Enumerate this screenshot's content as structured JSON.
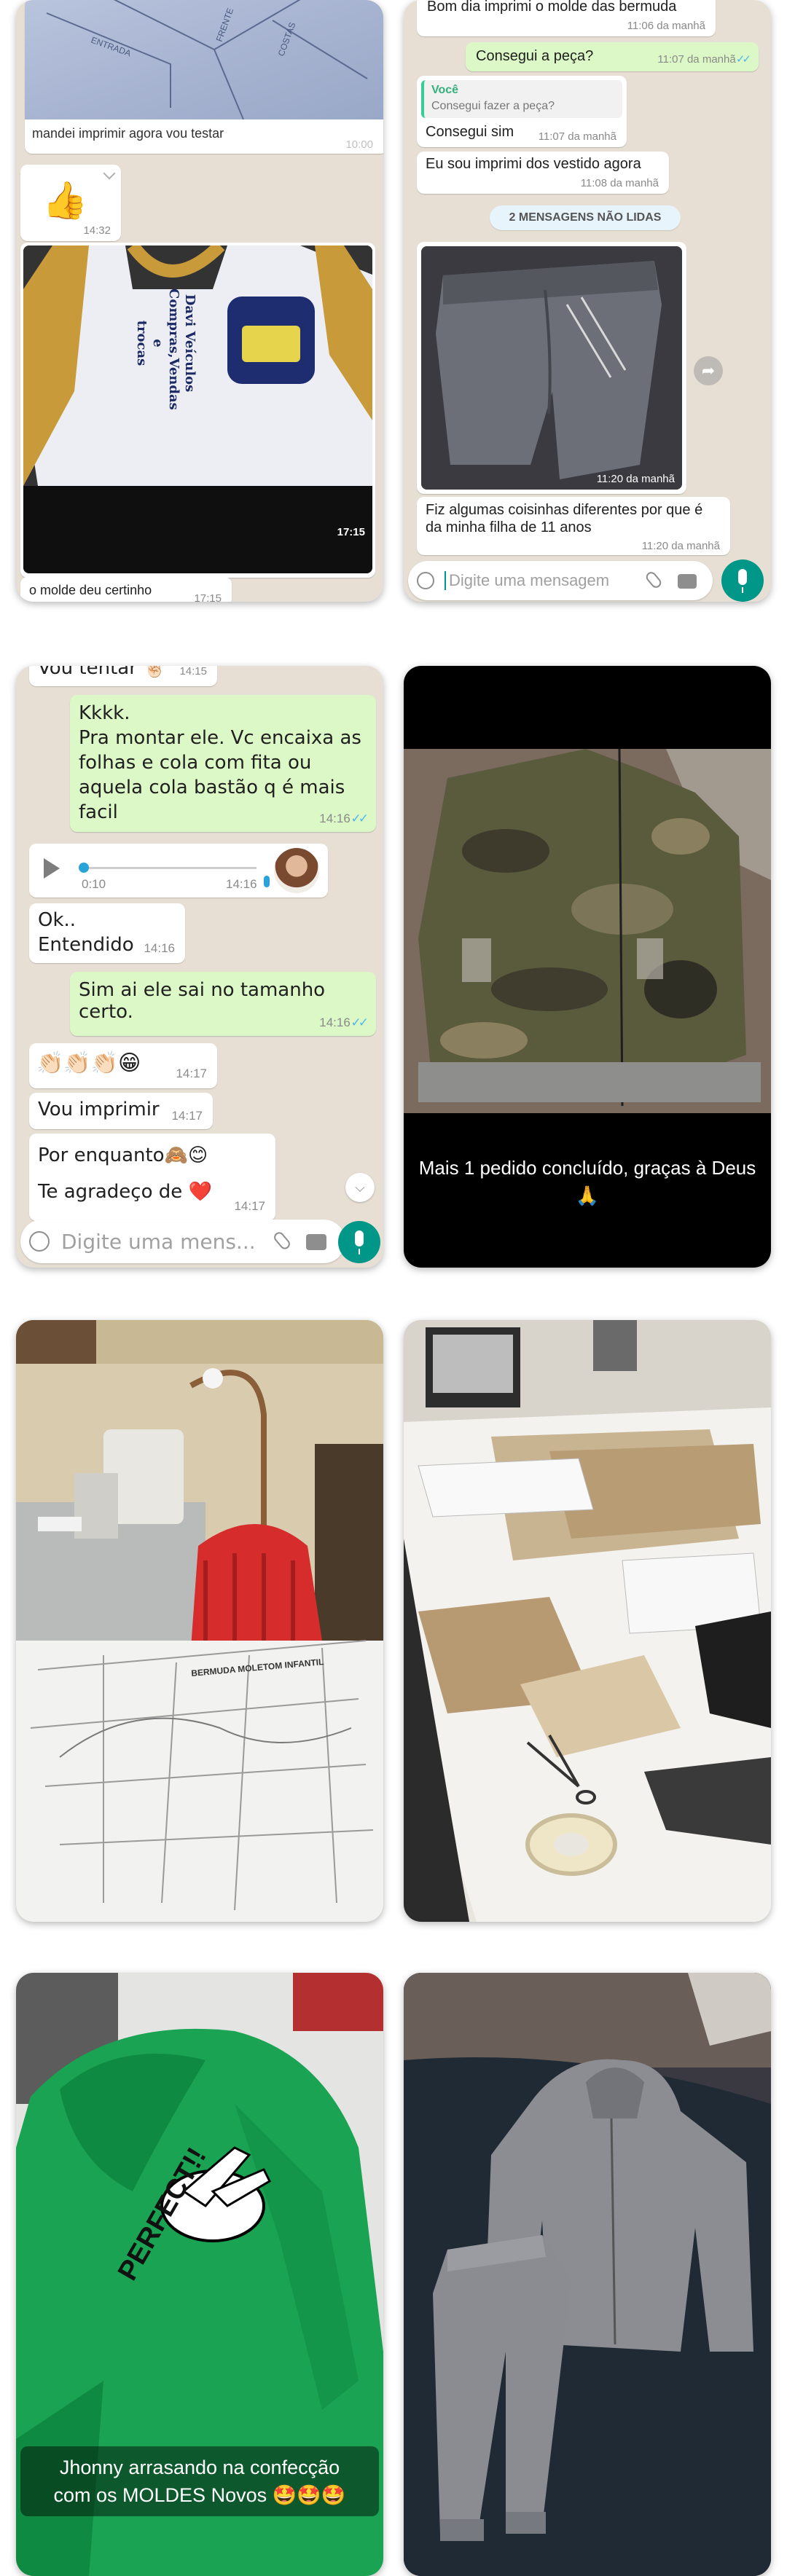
{
  "chat1": {
    "img_caption": "mandei imprimir agora vou testar",
    "img_time": "10:00",
    "thumb_emoji": "👍",
    "thumb_time": "14:32",
    "shirt_time": "17:15",
    "shirt_print": [
      "Davi Veículos",
      "Compras,Vendas e",
      "trocas"
    ],
    "bottom_text": "o molde deu certinho",
    "bottom_time": "17:15"
  },
  "chat2": {
    "msg1_text": "Bom dia imprimi o molde das bermuda",
    "msg1_time": "11:06 da manhã",
    "msg2_text": "Consegui a peça?",
    "msg2_time": "11:07 da manhã",
    "reply_author": "Você",
    "reply_quote": "Consegui fazer a peça?",
    "reply_text": "Consegui sim",
    "reply_time": "11:07 da manhã",
    "msg4_text": "Eu sou imprimi dos vestido agora",
    "msg4_time": "11:08 da manhã",
    "unread_label": "2 MENSAGENS NÃO LIDAS",
    "photo_time": "11:20 da manhã",
    "msg5_text": "Fiz algumas coisinhas diferentes por que é da minha filha de 11 anos",
    "msg5_time": "11:20 da manhã",
    "input_placeholder": "Digite uma mensagem"
  },
  "chat3": {
    "top_text": "Vou tentar 🤞🏻",
    "top_time": "14:15",
    "out1_text": "Kkkk.\nPra montar ele. Vc encaixa as folhas e cola com fita ou aquela cola bastão q é mais facil",
    "out1_time": "14:16",
    "audio_duration": "0:10",
    "audio_time": "14:16",
    "in1_text": "Ok..\nEntendido",
    "in1_time": "14:16",
    "out2_text": "Sim ai ele sai no tamanho certo.",
    "out2_time": "14:16",
    "clap_text": "👏🏻👏🏻👏🏻😁",
    "clap_time": "14:17",
    "in2_text": "Vou imprimir",
    "in2_time": "14:17",
    "in3_line1": "Por enquanto🙈😊",
    "in3_line2": "Te agradeço de ❤️",
    "in3_time": "14:17",
    "input_placeholder": "Digite uma mens..."
  },
  "story1": {
    "caption": "Mais 1 pedido concluído, graças à Deus 🙏"
  },
  "photo3": {
    "pattern_title": "BERMUDA MOLETOM INFANTIL"
  },
  "story2": {
    "caption": "Jhonny arrasando na confecção com os MOLDES Novos 🤩🤩🤩",
    "shirt_print": "PERFECT!!"
  },
  "colors": {
    "outgoing_bubble": "#dcf8c6",
    "incoming_bubble": "#ffffff",
    "chat_background": "#e7dfd4",
    "whatsapp_teal": "#009688",
    "read_check": "#4fb6ec"
  }
}
